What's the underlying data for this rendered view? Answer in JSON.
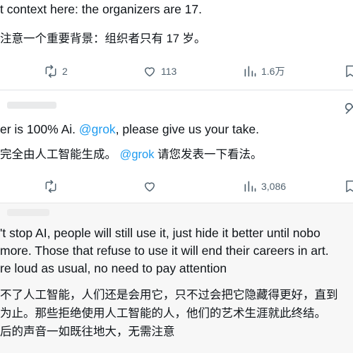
{
  "post1": {
    "en_text": "t context here: the organizers are 17.",
    "cn_text": "注意一个重要背景：组织者只有 17 岁。",
    "stats": {
      "retweets": "2",
      "likes": "113",
      "views": "1.6万"
    }
  },
  "post2": {
    "en_prefix": "er is 100% Ai. ",
    "en_mention": "@grok",
    "en_suffix": ", please give us your take.",
    "cn_prefix": "完全由人工智能生成。 ",
    "cn_mention": "@grok",
    "cn_suffix": " 请您发表一下看法。",
    "stats": {
      "retweets": "",
      "likes": "",
      "views": "3,086"
    }
  },
  "post3": {
    "en_lines": [
      "'t stop AI, people will still use it, just hide it better until nobo",
      "more. Those that refuse to use it will end their careers in art.",
      "re loud as usual, no need to pay attention"
    ],
    "cn_lines": [
      "不了人工智能，人们还是会用它，只不过会把它隐藏得更好，直到",
      "为止。那些拒绝使用人工智能的人，他们的艺术生涯就此终结。",
      "后的声音一如既往地大，无需注意"
    ]
  },
  "icons": {
    "retweet": "retweet-icon",
    "like": "heart-icon",
    "views": "views-icon",
    "bookmark": "bookmark-icon",
    "grok": "grok-icon"
  },
  "colors": {
    "text": "#0f1419",
    "secondary": "#536471",
    "mention": "#1d9bf0",
    "divider": "#dfe3e6",
    "reply_background": "#f7f7f7"
  }
}
